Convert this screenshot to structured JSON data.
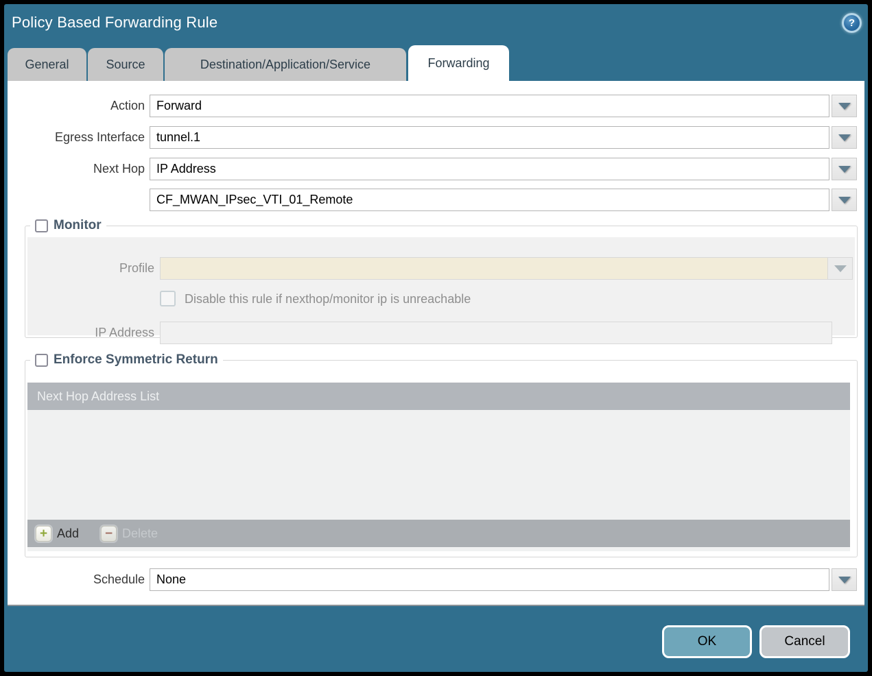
{
  "window": {
    "title": "Policy Based Forwarding Rule"
  },
  "icons": {
    "help": "?",
    "add_plus": "+",
    "delete_minus": "−"
  },
  "tabs": [
    {
      "label": "General",
      "active": false
    },
    {
      "label": "Source",
      "active": false
    },
    {
      "label": "Destination/Application/Service",
      "active": false
    },
    {
      "label": "Forwarding",
      "active": true
    }
  ],
  "form": {
    "action": {
      "label": "Action",
      "value": "Forward"
    },
    "egress_interface": {
      "label": "Egress Interface",
      "value": "tunnel.1"
    },
    "next_hop": {
      "label": "Next Hop",
      "value": "IP Address"
    },
    "next_hop_address": {
      "value": "CF_MWAN_IPsec_VTI_01_Remote"
    },
    "schedule": {
      "label": "Schedule",
      "value": "None"
    }
  },
  "monitor": {
    "legend": "Monitor",
    "checked": false,
    "profile": {
      "label": "Profile",
      "value": ""
    },
    "disable_rule_checkbox": {
      "label": "Disable this rule if nexthop/monitor ip is unreachable",
      "checked": false
    },
    "ip_address": {
      "label": "IP Address",
      "value": ""
    }
  },
  "symmetric_return": {
    "legend": "Enforce Symmetric Return",
    "checked": false,
    "table": {
      "header": "Next Hop Address List",
      "rows": []
    },
    "toolbar": {
      "add_label": "Add",
      "delete_label": "Delete",
      "delete_enabled": false
    }
  },
  "buttons": {
    "ok": "OK",
    "cancel": "Cancel"
  },
  "colors": {
    "background_teal": "#306f8e",
    "tab_gray": "#c6c6c6",
    "panel_white": "#ffffff",
    "disabled_field_cream": "#f2ecd9",
    "disabled_section_gray": "#f1f1f1",
    "table_header_gray": "#b2b6bb",
    "table_footer_gray": "#aaaeb2",
    "ok_button_blue": "#6fa6ba",
    "cancel_button_gray": "#c2c6ca",
    "dropdown_arrow_slate": "#5d7b8e",
    "add_plus_green": "#8fa83a",
    "delete_minus_red": "#a5695b"
  }
}
